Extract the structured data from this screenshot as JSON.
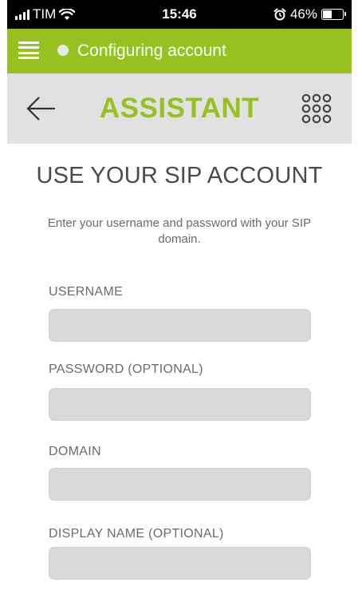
{
  "status_bar": {
    "carrier": "TIM",
    "time": "15:46",
    "alarm_icon": "alarm-icon",
    "battery_percent": "46%",
    "battery_level": 0.46
  },
  "app_bar": {
    "color": "#96c11f",
    "status_text": "Configuring account",
    "menu_icon": "hamburger-menu-icon",
    "status_dot_color": "#e8e8e8"
  },
  "assistant_header": {
    "title": "ASSISTANT",
    "title_color": "#96c11f",
    "back_icon": "back-arrow-icon",
    "dialer_icon": "dialpad-icon"
  },
  "form": {
    "title": "USE YOUR SIP ACCOUNT",
    "subtitle": "Enter your username and password with your SIP domain.",
    "fields": [
      {
        "label": "USERNAME",
        "value": "",
        "placeholder": ""
      },
      {
        "label": "PASSWORD (OPTIONAL)",
        "value": "",
        "placeholder": ""
      },
      {
        "label": "DOMAIN",
        "value": "",
        "placeholder": ""
      },
      {
        "label": "DISPLAY NAME (OPTIONAL)",
        "value": "",
        "placeholder": ""
      }
    ]
  }
}
